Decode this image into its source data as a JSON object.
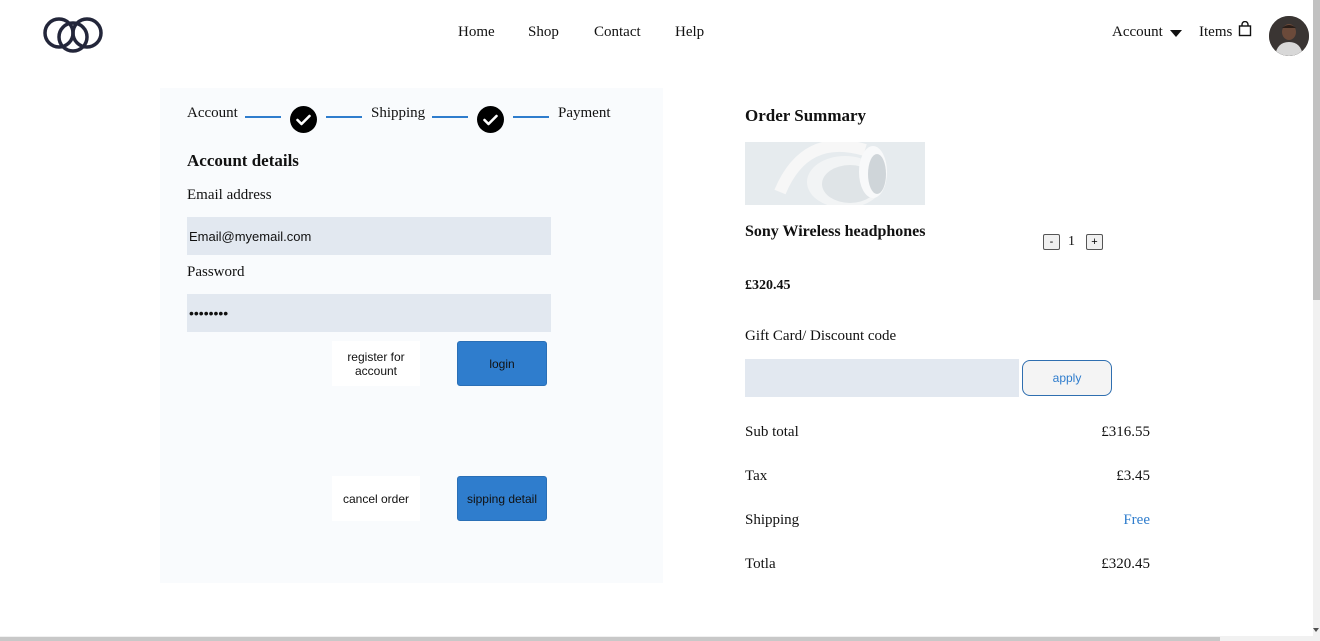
{
  "header": {
    "logo": "intertwined-rings-logo",
    "nav": [
      "Home",
      "Shop",
      "Contact",
      "Help"
    ],
    "account_label": "Account",
    "items_label": "Items"
  },
  "checkout": {
    "steps": [
      "Account",
      "Shipping",
      "Payment"
    ],
    "section_title": "Account details",
    "email_label": "Email address",
    "email_value": "Email@myemail.com",
    "password_label": "Password",
    "password_value": "••••••••",
    "register_label": "register for account",
    "login_label": "login",
    "cancel_label": "cancel order",
    "next_label": "sipping detail"
  },
  "summary": {
    "title": "Order Summary",
    "product_name": "Sony Wireless headphones",
    "quantity": "1",
    "minus": "-",
    "plus": "+",
    "price": "£320.45",
    "discount_label": "Gift Card/ Discount code",
    "discount_value": "",
    "apply_label": "apply",
    "rows": [
      {
        "label": "Sub total",
        "value": "£316.55"
      },
      {
        "label": "Tax",
        "value": "£3.45"
      },
      {
        "label": "Shipping",
        "value": "Free"
      },
      {
        "label": "Totla",
        "value": "£320.45"
      }
    ]
  },
  "colors": {
    "accent": "#2f7dcd",
    "input_bg": "#e2e8f0",
    "panel_bg": "#f9fbfd"
  }
}
